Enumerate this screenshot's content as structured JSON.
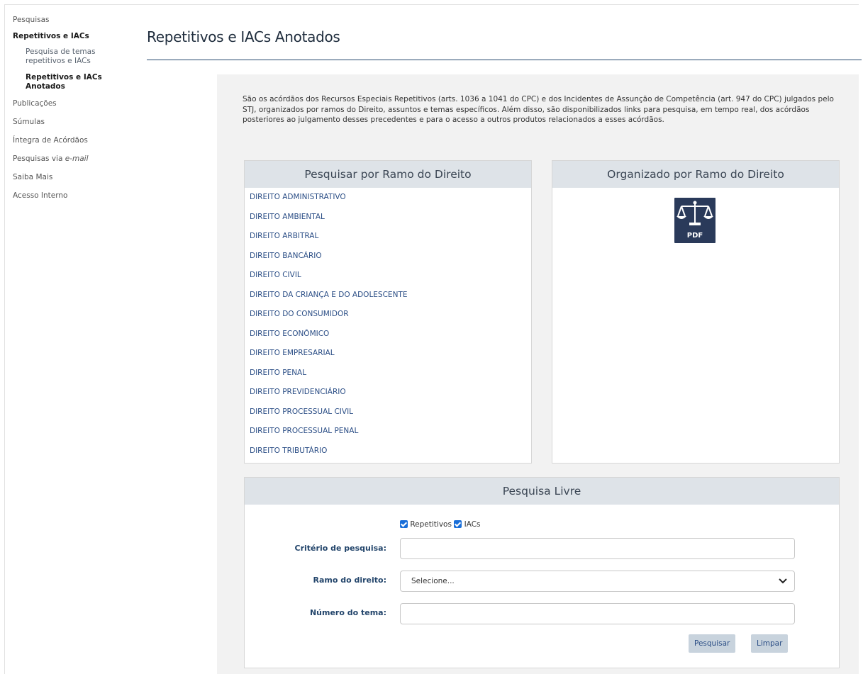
{
  "sidebar": {
    "items": [
      {
        "label": "Pesquisas"
      },
      {
        "label": "Repetitivos e IACs"
      },
      {
        "label": "Pesquisa de temas repetitivos e IACs"
      },
      {
        "label": "Repetitivos e IACs Anotados"
      },
      {
        "label": "Publicações"
      },
      {
        "label": "Súmulas"
      },
      {
        "label": "Íntegra de Acórdãos"
      },
      {
        "label_prefix": "Pesquisas via ",
        "label_em": "e-mail"
      },
      {
        "label": "Saiba Mais"
      },
      {
        "label": "Acesso Interno"
      }
    ]
  },
  "header": {
    "title": "Repetitivos e IACs Anotados"
  },
  "intro": "São os acórdãos dos Recursos Especiais Repetitivos (arts. 1036 a 1041 do CPC) e dos Incidentes de Assunção de Competência (art. 947 do CPC) julgados pelo STJ, organizados por ramos do Direito, assuntos e temas específicos. Além disso, são disponibilizados links para pesquisa, em tempo real, dos acórdãos posteriores ao julgamento desses precedentes e para o acesso a outros produtos relacionados a esses acórdãos.",
  "ramo_panel": {
    "title": "Pesquisar por Ramo do Direito",
    "items": [
      "DIREITO ADMINISTRATIVO",
      "DIREITO AMBIENTAL",
      "DIREITO ARBITRAL",
      "DIREITO BANCÁRIO",
      "DIREITO CIVIL",
      "DIREITO DA CRIANÇA E DO ADOLESCENTE",
      "DIREITO DO CONSUMIDOR",
      "DIREITO ECONÔMICO",
      "DIREITO EMPRESARIAL",
      "DIREITO PENAL",
      "DIREITO PREVIDENCIÁRIO",
      "DIREITO PROCESSUAL CIVIL",
      "DIREITO PROCESSUAL PENAL",
      "DIREITO TRIBUTÁRIO"
    ]
  },
  "org_panel": {
    "title": "Organizado por Ramo do Direito",
    "pdf_icon": "scales-pdf-icon",
    "pdf_label": "PDF"
  },
  "livre_panel": {
    "title": "Pesquisa Livre",
    "checkbox_repetitivos": "Repetitivos",
    "checkbox_iacs": "IACs",
    "criterio_label": "Critério de pesquisa:",
    "criterio_value": "",
    "ramo_label": "Ramo do direito:",
    "ramo_selected": "Selecione...",
    "numero_label": "Número do tema:",
    "numero_value": "",
    "search_button": "Pesquisar",
    "clear_button": "Limpar"
  },
  "colors": {
    "accent": "#23456b",
    "link": "#2a4d85",
    "panel_header": "#dee3e8",
    "content_bg": "#f2f2f2",
    "button_bg": "#c8d3dd",
    "checkbox": "#1a6fd9"
  }
}
